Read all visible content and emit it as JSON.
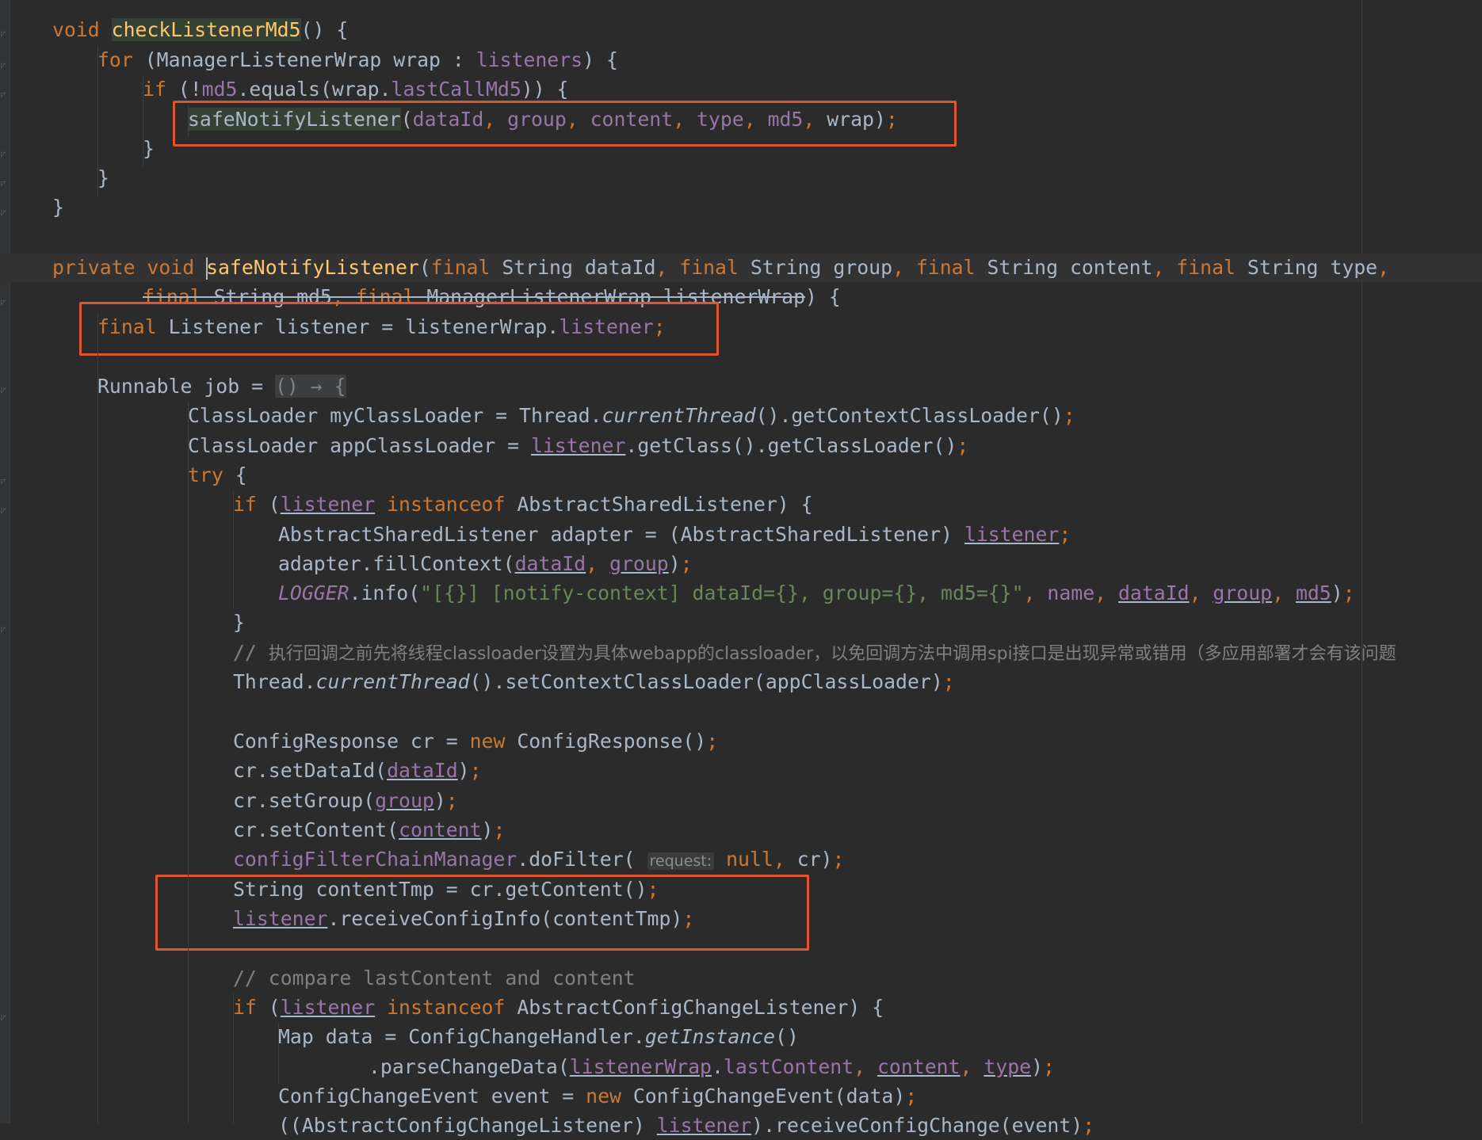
{
  "editor": {
    "colors": {
      "background": "#2b2b2b",
      "keyword": "#cc7832",
      "field": "#9876aa",
      "string": "#6a8759",
      "comment": "#808080",
      "method_decl": "#ffc66d",
      "annotation_box": "#e0552d"
    },
    "lines": [
      {
        "tokens": [
          [
            "kw",
            "void "
          ],
          [
            "decl hl-green",
            "checkListenerMd5"
          ],
          [
            "",
            "() {"
          ]
        ]
      },
      {
        "tokens": [
          [
            "kw",
            "for "
          ],
          [
            "",
            "(ManagerListenerWrap wrap : "
          ],
          [
            "fld",
            "listeners"
          ],
          [
            "",
            ") {"
          ]
        ]
      },
      {
        "tokens": [
          [
            "kw",
            "if "
          ],
          [
            "",
            "(!"
          ],
          [
            "fld",
            "md5"
          ],
          [
            "",
            ".equals(wrap."
          ],
          [
            "fld",
            "lastCallMd5"
          ],
          [
            "",
            ")) {"
          ]
        ]
      },
      {
        "tokens": [
          [
            "hl-green",
            "safeNotifyListener"
          ],
          [
            "",
            "("
          ],
          [
            "fld",
            "dataId"
          ],
          [
            "kw",
            ", "
          ],
          [
            "fld",
            "group"
          ],
          [
            "kw",
            ", "
          ],
          [
            "fld",
            "content"
          ],
          [
            "kw",
            ", "
          ],
          [
            "fld",
            "type"
          ],
          [
            "kw",
            ", "
          ],
          [
            "fld",
            "md5"
          ],
          [
            "kw",
            ", "
          ],
          [
            "",
            "wrap)"
          ],
          [
            "kw",
            ";"
          ]
        ]
      },
      {
        "tokens": [
          [
            "",
            "}"
          ]
        ]
      },
      {
        "tokens": [
          [
            "",
            "}"
          ]
        ]
      },
      {
        "tokens": [
          [
            "",
            "}"
          ]
        ]
      },
      {
        "tokens": [
          [
            "kw",
            "private void "
          ],
          [
            "caret",
            ""
          ],
          [
            "decl",
            "safeNotifyListener"
          ],
          [
            "",
            "("
          ],
          [
            "kw",
            "final "
          ],
          [
            "",
            "String dataId"
          ],
          [
            "kw",
            ", final "
          ],
          [
            "",
            "String group"
          ],
          [
            "kw",
            ", final "
          ],
          [
            "",
            "String content"
          ],
          [
            "kw",
            ", final "
          ],
          [
            "",
            "String type"
          ],
          [
            "kw",
            ","
          ]
        ]
      },
      {
        "tokens": [
          [
            "kw strike",
            "final "
          ],
          [
            "strike",
            "String md5"
          ],
          [
            "kw strike",
            ", final "
          ],
          [
            "strike",
            "ManagerListenerWrap listenerWrap"
          ],
          [
            "",
            ") {"
          ]
        ]
      },
      {
        "tokens": [
          [
            "kw",
            "final "
          ],
          [
            "",
            "Listener listener = listenerWrap."
          ],
          [
            "fld",
            "listener"
          ],
          [
            "kw",
            ";"
          ]
        ]
      },
      {
        "tokens": [
          [
            "",
            "Runnable job = "
          ],
          [
            "hl-lambda",
            "() → {"
          ]
        ]
      },
      {
        "tokens": [
          [
            "",
            "ClassLoader myClassLoader = Thread."
          ],
          [
            "ital",
            "currentThread"
          ],
          [
            "",
            "().getContextClassLoader()"
          ],
          [
            "kw",
            ";"
          ]
        ]
      },
      {
        "tokens": [
          [
            "",
            "ClassLoader appClassLoader = "
          ],
          [
            "fld und",
            "listener"
          ],
          [
            "",
            ".getClass().getClassLoader()"
          ],
          [
            "kw",
            ";"
          ]
        ]
      },
      {
        "tokens": [
          [
            "kw",
            "try "
          ],
          [
            "",
            "{"
          ]
        ]
      },
      {
        "tokens": [
          [
            "kw",
            "if "
          ],
          [
            "",
            "("
          ],
          [
            "fld und",
            "listener"
          ],
          [
            "kw",
            " instanceof "
          ],
          [
            "",
            "AbstractSharedListener) {"
          ]
        ]
      },
      {
        "tokens": [
          [
            "",
            "AbstractSharedListener adapter = (AbstractSharedListener) "
          ],
          [
            "fld und",
            "listener"
          ],
          [
            "kw",
            ";"
          ]
        ]
      },
      {
        "tokens": [
          [
            "",
            "adapter.fillContext("
          ],
          [
            "fld und",
            "dataId"
          ],
          [
            "kw",
            ", "
          ],
          [
            "fld und",
            "group"
          ],
          [
            "",
            ")"
          ],
          [
            "kw",
            ";"
          ]
        ]
      },
      {
        "tokens": [
          [
            "fld ital",
            "LOGGER"
          ],
          [
            "",
            ".info("
          ],
          [
            "str",
            "\"[{}] [notify-context] dataId={}, group={}, md5={}\""
          ],
          [
            "kw",
            ", "
          ],
          [
            "fld",
            "name"
          ],
          [
            "kw",
            ", "
          ],
          [
            "fld und",
            "dataId"
          ],
          [
            "kw",
            ", "
          ],
          [
            "fld und",
            "group"
          ],
          [
            "kw",
            ", "
          ],
          [
            "fld und",
            "md5"
          ],
          [
            "",
            ")"
          ],
          [
            "kw",
            ";"
          ]
        ]
      },
      {
        "tokens": [
          [
            "",
            "}"
          ]
        ]
      },
      {
        "tokens": [
          [
            "com",
            "// "
          ],
          [
            "com cjk",
            "执行回调之前先将线程classloader设置为具体webapp的classloader，以免回调方法中调用spi接口是出现异常或错用（多应用部署才会有该问题"
          ]
        ]
      },
      {
        "tokens": [
          [
            "",
            "Thread."
          ],
          [
            "ital",
            "currentThread"
          ],
          [
            "",
            "().setContextClassLoader(appClassLoader)"
          ],
          [
            "kw",
            ";"
          ]
        ]
      },
      {
        "tokens": [
          [
            "",
            "ConfigResponse cr = "
          ],
          [
            "kw",
            "new "
          ],
          [
            "",
            "ConfigResponse()"
          ],
          [
            "kw",
            ";"
          ]
        ]
      },
      {
        "tokens": [
          [
            "",
            "cr.setDataId("
          ],
          [
            "fld und",
            "dataId"
          ],
          [
            "",
            ")"
          ],
          [
            "kw",
            ";"
          ]
        ]
      },
      {
        "tokens": [
          [
            "",
            "cr.setGroup("
          ],
          [
            "fld und",
            "group"
          ],
          [
            "",
            ")"
          ],
          [
            "kw",
            ";"
          ]
        ]
      },
      {
        "tokens": [
          [
            "",
            "cr.setContent("
          ],
          [
            "fld und",
            "content"
          ],
          [
            "",
            ")"
          ],
          [
            "kw",
            ";"
          ]
        ]
      },
      {
        "tokens": [
          [
            "fld",
            "configFilterChainManager"
          ],
          [
            "",
            ".doFilter( "
          ],
          [
            "hint",
            "request:"
          ],
          [
            "kw",
            " null"
          ],
          [
            "kw",
            ", "
          ],
          [
            "",
            "cr)"
          ],
          [
            "kw",
            ";"
          ]
        ]
      },
      {
        "tokens": [
          [
            "",
            "String contentTmp = cr.getContent()"
          ],
          [
            "kw",
            ";"
          ]
        ]
      },
      {
        "tokens": [
          [
            "fld und",
            "listener"
          ],
          [
            "",
            ".receiveConfigInfo(contentTmp)"
          ],
          [
            "kw",
            ";"
          ]
        ]
      },
      {
        "tokens": [
          [
            "com",
            "// compare lastContent and content"
          ]
        ]
      },
      {
        "tokens": [
          [
            "kw",
            "if "
          ],
          [
            "",
            "("
          ],
          [
            "fld und",
            "listener"
          ],
          [
            "kw",
            " instanceof "
          ],
          [
            "",
            "AbstractConfigChangeListener) {"
          ]
        ]
      },
      {
        "tokens": [
          [
            "",
            "Map data = ConfigChangeHandler."
          ],
          [
            "ital",
            "getInstance"
          ],
          [
            "",
            "()"
          ]
        ]
      },
      {
        "tokens": [
          [
            "",
            ".parseChangeData("
          ],
          [
            "fld und",
            "listenerWrap"
          ],
          [
            "",
            "."
          ],
          [
            "fld",
            "lastContent"
          ],
          [
            "kw",
            ", "
          ],
          [
            "fld und",
            "content"
          ],
          [
            "kw",
            ", "
          ],
          [
            "fld und",
            "type"
          ],
          [
            "",
            ")"
          ],
          [
            "kw",
            ";"
          ]
        ]
      },
      {
        "tokens": [
          [
            "",
            "ConfigChangeEvent event = "
          ],
          [
            "kw",
            "new "
          ],
          [
            "",
            "ConfigChangeEvent(data)"
          ],
          [
            "kw",
            ";"
          ]
        ]
      },
      {
        "tokens": [
          [
            "",
            "((AbstractConfigChangeListener) "
          ],
          [
            "fld und",
            "listener"
          ],
          [
            "",
            ").receiveConfigChange(event)"
          ],
          [
            "kw",
            ";"
          ]
        ]
      }
    ]
  }
}
